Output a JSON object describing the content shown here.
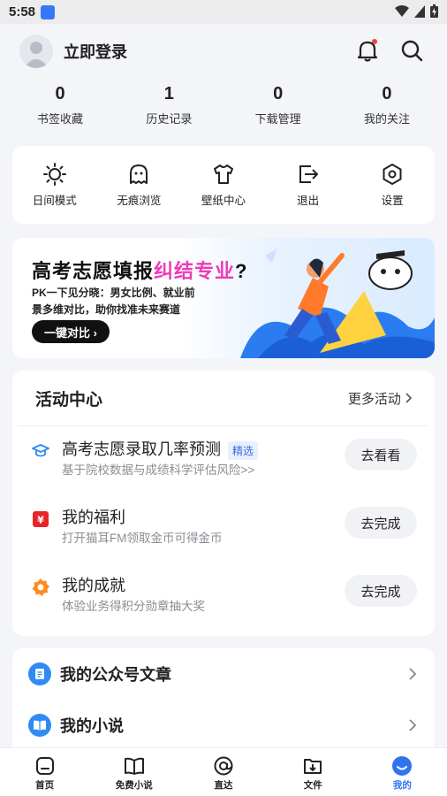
{
  "status_bar": {
    "time": "5:58"
  },
  "header": {
    "login_text": "立即登录"
  },
  "stats": [
    {
      "value": "0",
      "label": "书签收藏"
    },
    {
      "value": "1",
      "label": "历史记录"
    },
    {
      "value": "0",
      "label": "下载管理"
    },
    {
      "value": "0",
      "label": "我的关注"
    }
  ],
  "tools": [
    {
      "label": "日间模式",
      "icon": "sun-icon"
    },
    {
      "label": "无痕浏览",
      "icon": "ghost-icon"
    },
    {
      "label": "壁纸中心",
      "icon": "shirt-icon"
    },
    {
      "label": "退出",
      "icon": "exit-icon"
    },
    {
      "label": "设置",
      "icon": "gear-icon"
    }
  ],
  "banner": {
    "title_main": "高考志愿填报",
    "title_highlight": "纠结专业",
    "title_end": "?",
    "subtitle_1": "PK一下见分晓：男女比例、就业前",
    "subtitle_2": "景多维对比，助你找准未来赛道",
    "button_label": "一键对比 ›"
  },
  "activity": {
    "title": "活动中心",
    "more_label": "更多活动",
    "items": [
      {
        "title": "高考志愿录取几率预测",
        "tag": "精选",
        "desc": "基于院校数据与成绩科学评估风险>>",
        "button": "去看看",
        "icon": "graduation-cap-icon"
      },
      {
        "title": "我的福利",
        "tag": "",
        "desc": "打开猫耳FM领取金币可得金币",
        "button": "去完成",
        "icon": "yen-icon"
      },
      {
        "title": "我的成就",
        "tag": "",
        "desc": "体验业务得积分勋章抽大奖",
        "button": "去完成",
        "icon": "medal-icon"
      }
    ]
  },
  "list": [
    {
      "label": "我的公众号文章",
      "icon": "article-icon"
    },
    {
      "label": "我的小说",
      "icon": "book-icon"
    }
  ],
  "tabs": [
    {
      "label": "首页",
      "icon": "home-icon"
    },
    {
      "label": "免费小说",
      "icon": "open-book-icon"
    },
    {
      "label": "直达",
      "icon": "at-icon"
    },
    {
      "label": "文件",
      "icon": "folder-download-icon"
    },
    {
      "label": "我的",
      "icon": "smile-icon",
      "active": true
    }
  ],
  "colors": {
    "accent": "#2f73f0",
    "highlight": "#ee3bb7",
    "notification_dot": "#f0453a"
  }
}
